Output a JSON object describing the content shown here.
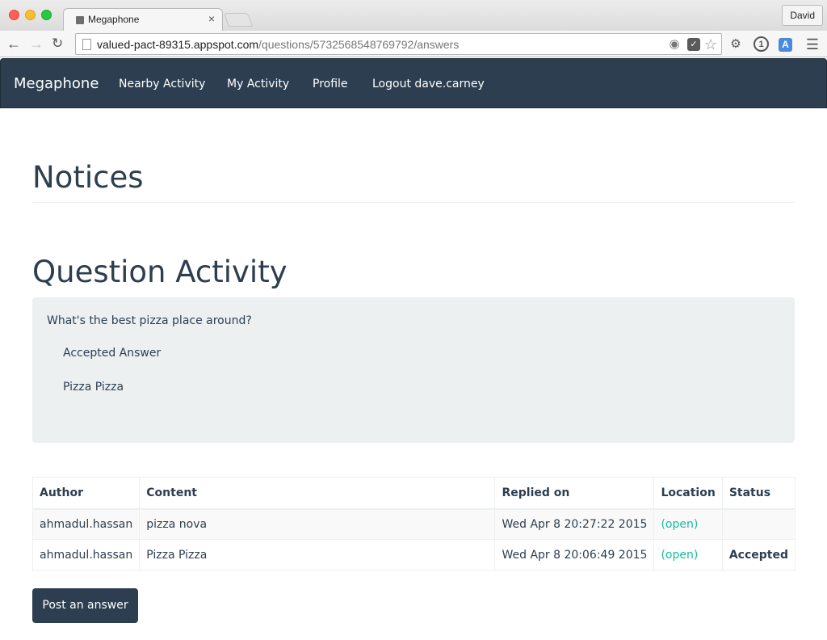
{
  "browser": {
    "tab_title": "Megaphone",
    "tab_close": "×",
    "profile_name": "David",
    "url_host": "valued-pact-89315.appspot.com",
    "url_path": "/questions/5732568548769792/answers",
    "icons": [
      "back-arrow-icon",
      "forward-arrow-icon",
      "reload-icon",
      "page-icon",
      "location-target-icon",
      "extension-icon",
      "bookmark-star-icon",
      "menu-icon"
    ]
  },
  "navbar": {
    "brand": "Megaphone",
    "links": [
      "Nearby Activity",
      "My Activity",
      "Profile",
      "Logout dave.carney"
    ],
    "background": "#2c3e50"
  },
  "notices": {
    "heading": "Notices"
  },
  "question_activity": {
    "heading": "Question Activity",
    "question": "What's the best pizza place around?",
    "accepted_label": "Accepted Answer",
    "accepted_value": "Pizza Pizza"
  },
  "answers_table": {
    "headers": [
      "Author",
      "Content",
      "Replied on",
      "Location",
      "Status"
    ],
    "rows": [
      {
        "author": "ahmadul.hassan",
        "content": "pizza nova",
        "replied_on": "Wed Apr 8 20:27:22 2015",
        "location": "(open)",
        "status": ""
      },
      {
        "author": "ahmadul.hassan",
        "content": "Pizza Pizza",
        "replied_on": "Wed Apr 8 20:06:49 2015",
        "location": "(open)",
        "status": "Accepted"
      }
    ],
    "link_color": "#18bc9c"
  },
  "actions": {
    "post_answer": "Post an answer"
  }
}
